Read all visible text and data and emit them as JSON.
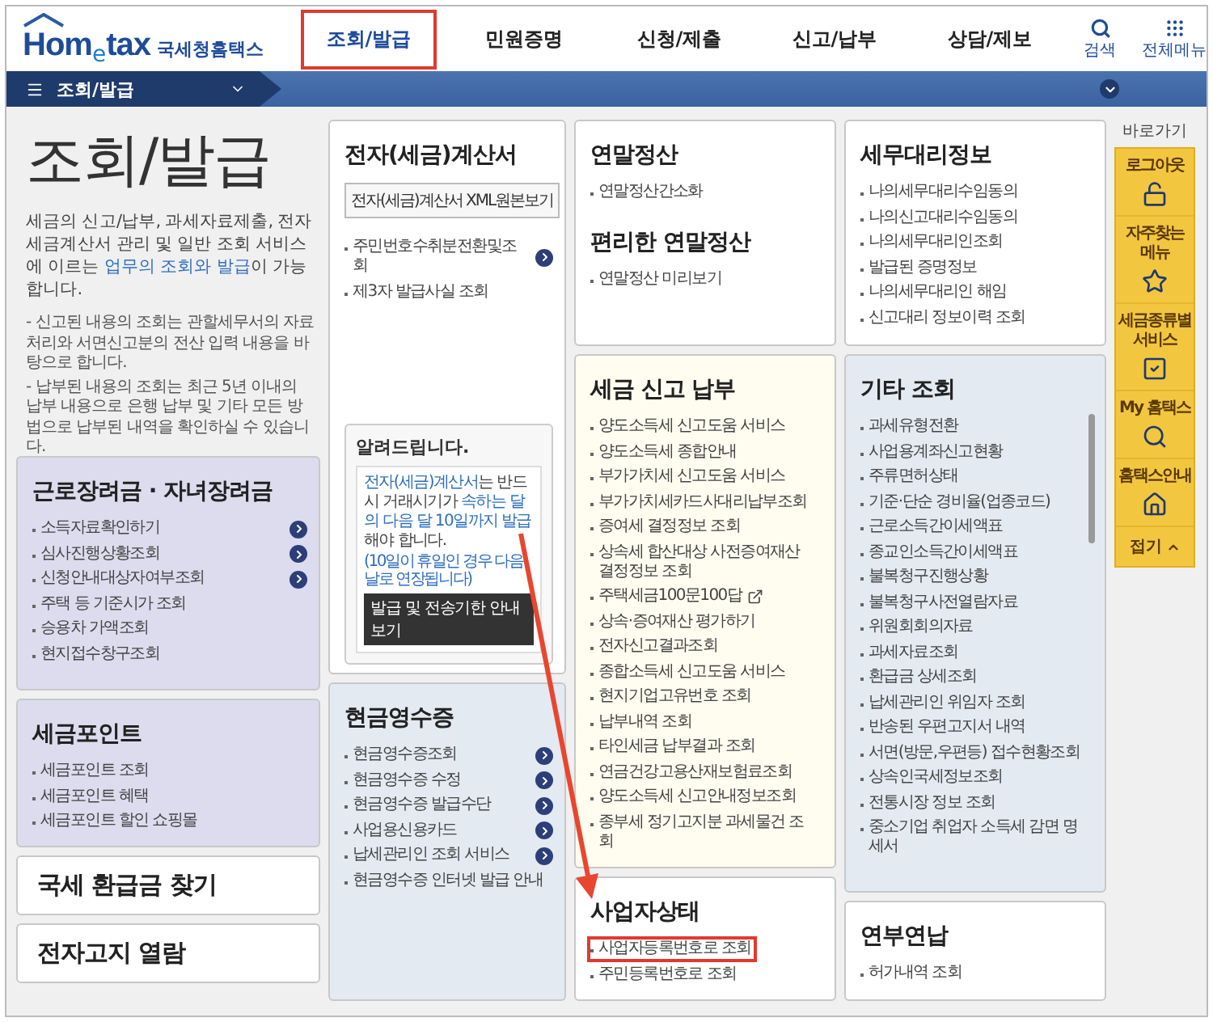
{
  "header": {
    "logo": {
      "wordmark_main": "Hom",
      "wordmark_e": "e",
      "wordmark_end": "tax",
      "name": "국세청홈택스"
    },
    "nav": [
      {
        "label": "조회/발급",
        "highlighted": true
      },
      {
        "label": "민원증명",
        "highlighted": false
      },
      {
        "label": "신청/제출",
        "highlighted": false
      },
      {
        "label": "신고/납부",
        "highlighted": false
      },
      {
        "label": "상담/제보",
        "highlighted": false
      }
    ],
    "tools": [
      "검색",
      "전체메뉴"
    ]
  },
  "breadcrumb": {
    "label": "조회/발급"
  },
  "intro": {
    "title": "조회/발급",
    "text": [
      {
        "text": "세금의 신고/납부, 과세자료제출, 전자세금계산서 관리 및 일반 조회 서비스에 이르는 ",
        "emphasis": false
      },
      {
        "text": "업무의 조회와 발급",
        "emphasis": true
      },
      {
        "text": "이 가능합니다.",
        "emphasis": false
      }
    ],
    "notes": [
      "- 신고된 내용의 조회는 관할세무서의 자료처리와 서면신고분의 전산 입력 내용을 바탕으로 합니다.",
      "- 납부된 내용의 조회는 최근 5년 이내의 납부 내용으로 은행 납부 및 기타 모든 방법으로 납부된 내역을 확인하실 수 있습니다."
    ]
  },
  "columns": [
    [
      {
        "kind": "list",
        "color": "#dcdcee",
        "sections": [
          {
            "title": "근로장려금 · 자녀장려금",
            "items": [
              {
                "label": "소득자료확인하기",
                "kind": "arrow"
              },
              {
                "label": "심사진행상황조회",
                "kind": "arrow"
              },
              {
                "label": "신청안내대상자여부조회",
                "kind": "arrow"
              },
              {
                "label": "주택 등 기준시가 조회",
                "kind": "plain"
              },
              {
                "label": "승용차 가액조회",
                "kind": "plain"
              },
              {
                "label": "현지접수창구조회",
                "kind": "plain"
              }
            ]
          }
        ]
      },
      {
        "kind": "list",
        "color": "#dcdcee",
        "sections": [
          {
            "title": "세금포인트",
            "items": [
              {
                "label": "세금포인트 조회",
                "kind": "plain"
              },
              {
                "label": "세금포인트 혜택",
                "kind": "plain"
              },
              {
                "label": "세금포인트 할인 쇼핑몰",
                "kind": "plain"
              }
            ]
          }
        ]
      },
      {
        "kind": "banner",
        "color": "#ffffff",
        "sections": [
          {
            "title": "국세 환급금 찾기"
          }
        ]
      },
      {
        "kind": "banner",
        "color": "#ffffff",
        "sections": [
          {
            "title": "전자고지 열람"
          }
        ]
      }
    ],
    [
      {
        "kind": "list",
        "color": "#ffffff",
        "button": "전자(세금)계산서 XML원본보기",
        "sections": [
          {
            "title": "전자(세금)계산서",
            "items": [
              {
                "label": "주민번호수취분전환및조회",
                "kind": "arrow"
              },
              {
                "label": "제3자 발급사실 조회",
                "kind": "plain"
              }
            ]
          }
        ],
        "notice": {
          "title": "알려드립니다.",
          "text": [
            {
              "text": "전자(세금)계산서",
              "emphasis": true
            },
            {
              "text": "는 반드시 거래시기가 ",
              "emphasis": false
            },
            {
              "text": "속하는 달의 다음 달 10일까지 발급",
              "emphasis": true
            },
            {
              "text": "해야 합니다.",
              "emphasis": false
            }
          ],
          "footnote": "(10일이 휴일인 경우 다음날로 연장됩니다)",
          "button": "발급 및 전송기한 안내보기"
        }
      },
      {
        "kind": "list",
        "color": "#e3eaf2",
        "sections": [
          {
            "title": "현금영수증",
            "items": [
              {
                "label": "현금영수증조회",
                "kind": "arrow"
              },
              {
                "label": "현금영수증 수정",
                "kind": "arrow"
              },
              {
                "label": "현금영수증 발급수단",
                "kind": "arrow"
              },
              {
                "label": "사업용신용카드",
                "kind": "arrow"
              },
              {
                "label": "납세관리인 조회 서비스",
                "kind": "arrow"
              },
              {
                "label": "현금영수증 인터넷 발급 안내",
                "kind": "plain"
              }
            ]
          }
        ]
      }
    ],
    [
      {
        "kind": "list",
        "color": "#ffffff",
        "sections": [
          {
            "title": "연말정산",
            "items": [
              {
                "label": "연말정산간소화",
                "kind": "plain"
              }
            ]
          },
          {
            "title": "편리한 연말정산",
            "items": [
              {
                "label": "연말정산 미리보기",
                "kind": "plain"
              }
            ]
          }
        ]
      },
      {
        "kind": "list",
        "color": "#fefdf0",
        "sections": [
          {
            "title": "세금 신고 납부",
            "items": [
              {
                "label": "양도소득세 신고도움 서비스",
                "kind": "plain"
              },
              {
                "label": "양도소득세 종합안내",
                "kind": "plain"
              },
              {
                "label": "부가가치세 신고도움 서비스",
                "kind": "plain"
              },
              {
                "label": "부가가치세카드사대리납부조회",
                "kind": "plain"
              },
              {
                "label": "증여세 결정정보 조회",
                "kind": "plain"
              },
              {
                "label": "상속세 합산대상 사전증여재산 결정정보 조회",
                "kind": "plain"
              },
              {
                "label": "주택세금100문100답",
                "kind": "external"
              },
              {
                "label": "상속·증여재산 평가하기",
                "kind": "plain"
              },
              {
                "label": "전자신고결과조회",
                "kind": "plain"
              },
              {
                "label": "종합소득세 신고도움 서비스",
                "kind": "plain"
              },
              {
                "label": "현지기업고유번호 조회",
                "kind": "plain"
              },
              {
                "label": "납부내역 조회",
                "kind": "plain"
              },
              {
                "label": "타인세금 납부결과 조회",
                "kind": "plain"
              },
              {
                "label": "연금건강고용산재보험료조회",
                "kind": "plain"
              },
              {
                "label": "양도소득세 신고안내정보조회",
                "kind": "plain"
              },
              {
                "label": "종부세 정기고지분 과세물건 조회",
                "kind": "plain"
              }
            ]
          }
        ]
      },
      {
        "kind": "list",
        "color": "#ffffff",
        "sections": [
          {
            "title": "사업자상태",
            "items": [
              {
                "label": "사업자등록번호로 조회",
                "kind": "plain",
                "highlighted": true
              },
              {
                "label": "주민등록번호로 조회",
                "kind": "plain",
                "highlighted": false
              }
            ]
          }
        ]
      }
    ],
    [
      {
        "kind": "list",
        "color": "#ffffff",
        "sections": [
          {
            "title": "세무대리정보",
            "items": [
              {
                "label": "나의세무대리수임동의",
                "kind": "plain"
              },
              {
                "label": "나의신고대리수임동의",
                "kind": "plain"
              },
              {
                "label": "나의세무대리인조회",
                "kind": "plain"
              },
              {
                "label": "발급된 증명정보",
                "kind": "plain"
              },
              {
                "label": "나의세무대리인 해임",
                "kind": "plain"
              },
              {
                "label": "신고대리 정보이력 조회",
                "kind": "plain"
              }
            ]
          }
        ]
      },
      {
        "kind": "scroll",
        "color": "#e3eaf2",
        "sections": [
          {
            "title": "기타 조회",
            "items": [
              {
                "label": "과세유형전환",
                "kind": "plain"
              },
              {
                "label": "사업용계좌신고현황",
                "kind": "plain"
              },
              {
                "label": "주류면허상태",
                "kind": "plain"
              },
              {
                "label": "기준·단순 경비율(업종코드)",
                "kind": "plain"
              },
              {
                "label": "근로소득간이세액표",
                "kind": "plain"
              },
              {
                "label": "종교인소득간이세액표",
                "kind": "plain"
              },
              {
                "label": "불복청구진행상황",
                "kind": "plain"
              },
              {
                "label": "불복청구사전열람자료",
                "kind": "plain"
              },
              {
                "label": "위원회회의자료",
                "kind": "plain"
              },
              {
                "label": "과세자료조회",
                "kind": "plain"
              },
              {
                "label": "환급금 상세조회",
                "kind": "plain"
              },
              {
                "label": "납세관리인 위임자 조회",
                "kind": "plain"
              },
              {
                "label": "반송된 우편고지서 내역",
                "kind": "plain"
              },
              {
                "label": "서면(방문,우편등) 접수현황조회",
                "kind": "plain"
              },
              {
                "label": "상속인국세정보조회",
                "kind": "plain"
              },
              {
                "label": "전통시장 정보 조회",
                "kind": "plain"
              },
              {
                "label": "중소기업 취업자 소득세 감면 명세서",
                "kind": "plain"
              }
            ]
          }
        ]
      },
      {
        "kind": "list",
        "color": "#ffffff",
        "sections": [
          {
            "title": "연부연납",
            "items": [
              {
                "label": "허가내역 조회",
                "kind": "plain"
              }
            ]
          }
        ]
      }
    ]
  ],
  "quick_menu": {
    "title": "바로가기",
    "items": [
      "로그아웃",
      "자주찾는 메뉴",
      "세금종류별 서비스",
      "My 홈택스",
      "홈택스안내"
    ],
    "collapse": "접기"
  },
  "annotations": [
    {
      "kind": "arrow"
    }
  ]
}
